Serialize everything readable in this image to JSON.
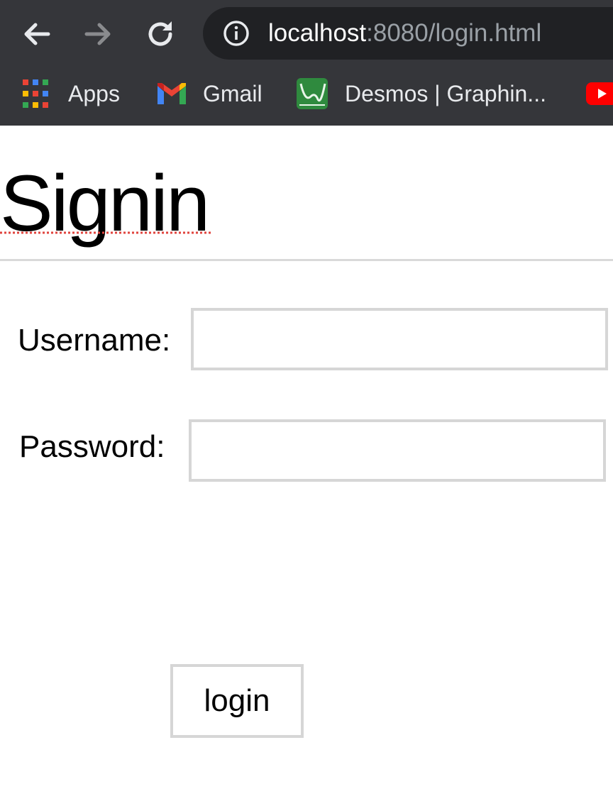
{
  "browser": {
    "url_host": "localhost",
    "url_path": ":8080/login.html",
    "icons": {
      "back": "arrow-left-icon",
      "forward": "arrow-right-icon",
      "reload": "reload-icon",
      "site_info": "info-icon"
    },
    "bookmarks": [
      {
        "label": "Apps",
        "icon": "apps-grid-icon"
      },
      {
        "label": "Gmail",
        "icon": "gmail-icon"
      },
      {
        "label": "Desmos | Graphin...",
        "icon": "desmos-icon"
      },
      {
        "label": "",
        "icon": "youtube-icon"
      }
    ],
    "colors": {
      "toolbar": "#35363a",
      "omnibox": "#202124",
      "text": "#e8eaed",
      "dim_text": "#9aa0a6"
    }
  },
  "page": {
    "title": "Signin",
    "username_label": "Username:",
    "username_value": "",
    "password_label": "Password:",
    "password_value": "",
    "login_label": "login"
  }
}
